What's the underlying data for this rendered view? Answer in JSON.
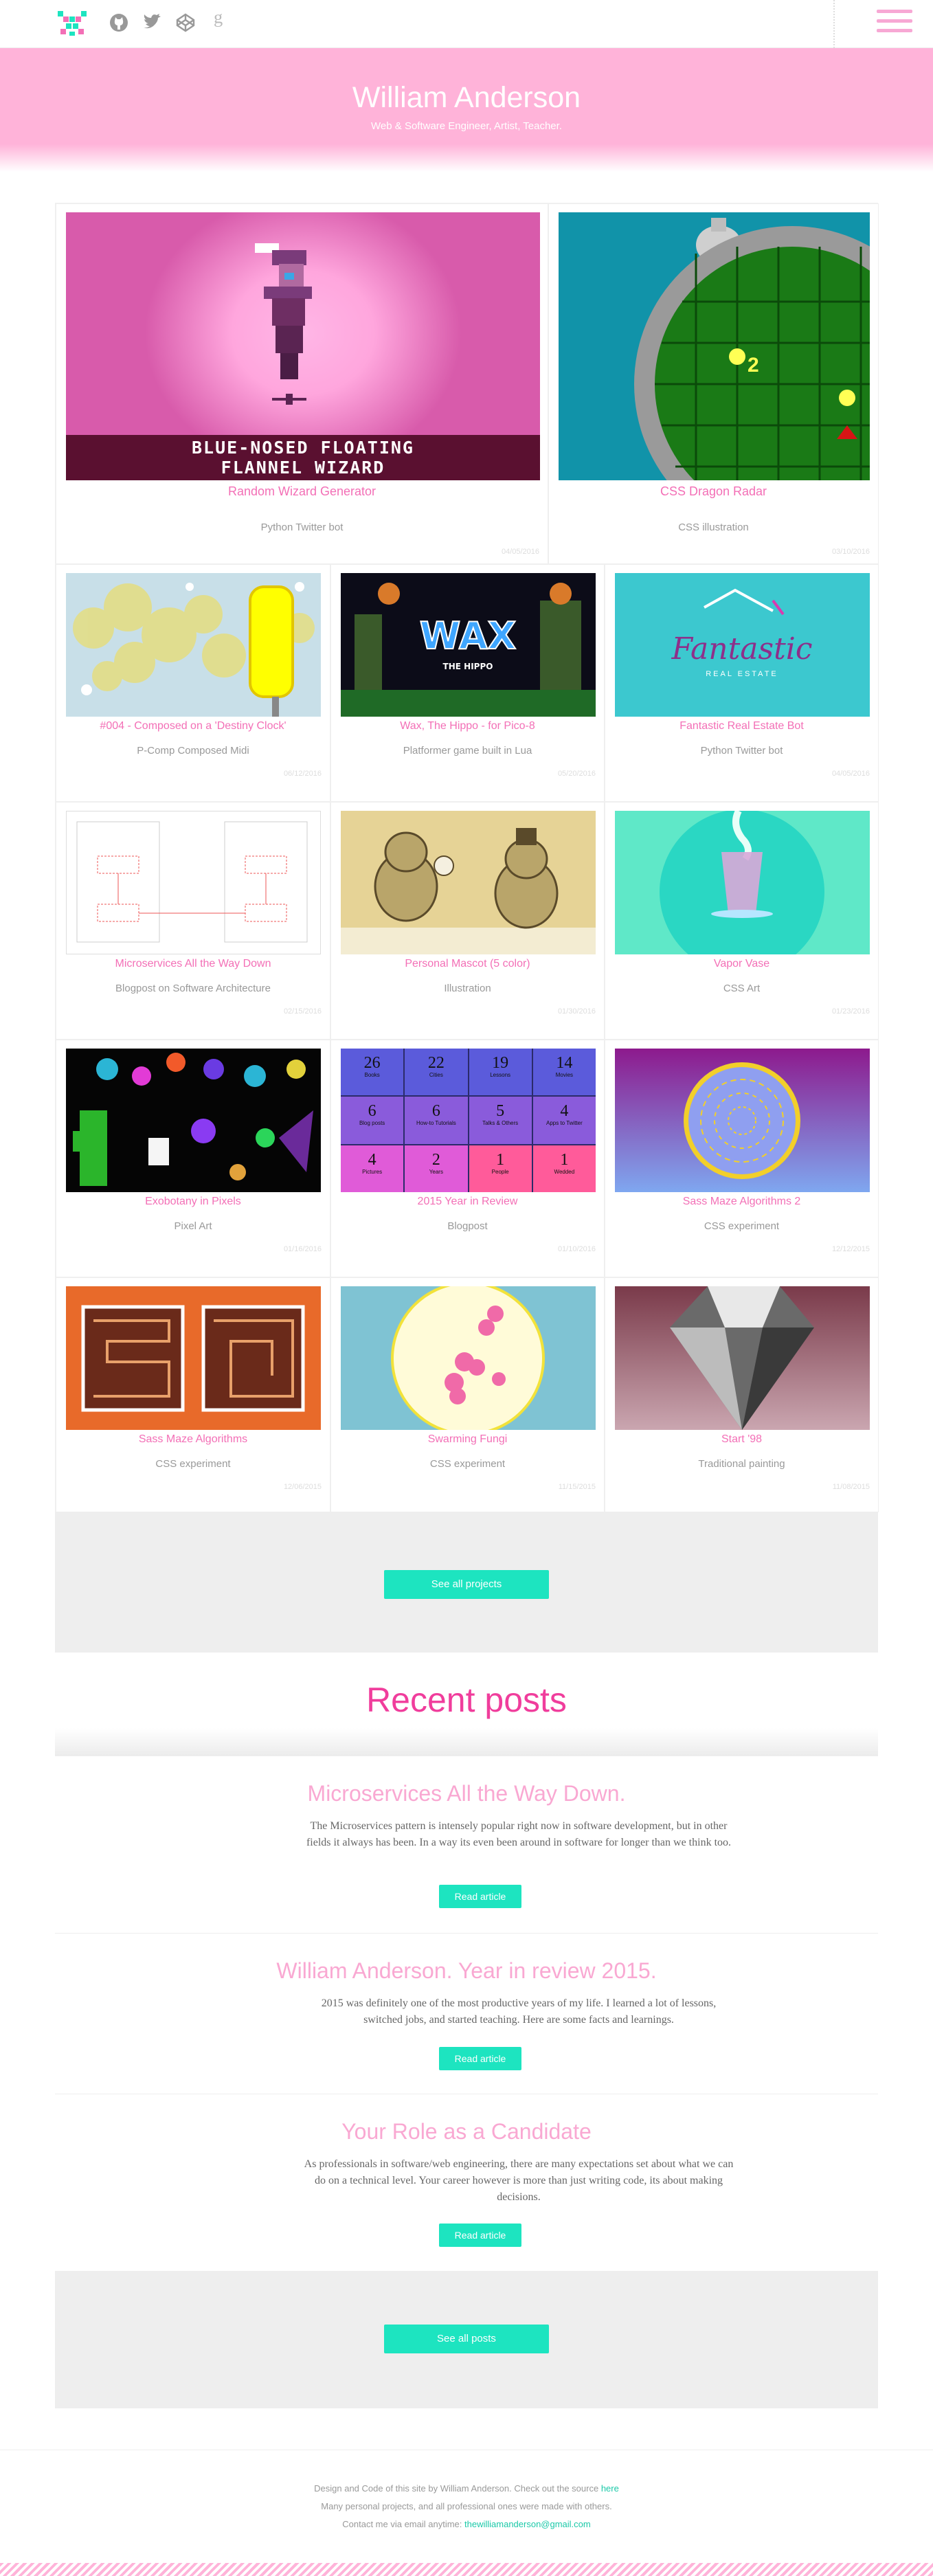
{
  "site": {
    "title": "William Anderson",
    "tagline": "Web & Software Engineer, Artist, Teacher."
  },
  "nav": {
    "icons": [
      "logo-icon",
      "github-icon",
      "twitter-icon",
      "codepen-icon",
      "goodreads-icon"
    ],
    "menu_icon": "hamburger-icon"
  },
  "colors": {
    "accent_pink": "#f36fb6",
    "hero_pink": "#ffb3d9",
    "button_teal": "#1de4c0"
  },
  "projects": [
    {
      "title": "Random Wizard Generator",
      "subtitle": "Python Twitter bot",
      "date": "04/05/2016",
      "thumb_text": [
        "BLUE-NOSED FLOATING",
        "FLANNEL WIZARD"
      ]
    },
    {
      "title": "CSS Dragon Radar",
      "subtitle": "CSS illustration",
      "date": "03/10/2016",
      "thumb_text": [
        "2"
      ]
    },
    {
      "title": "#004 - Composed on a 'Destiny Clock'",
      "subtitle": "P-Comp Composed Midi",
      "date": "06/12/2016"
    },
    {
      "title": "Wax, The Hippo - for Pico-8",
      "subtitle": "Platformer game built in Lua",
      "date": "05/20/2016",
      "thumb_text": [
        "WAX",
        "THE HIPPO"
      ]
    },
    {
      "title": "Fantastic Real Estate Bot",
      "subtitle": "Python Twitter bot",
      "date": "04/05/2016",
      "thumb_text": [
        "Fantastic",
        "REAL ESTATE"
      ]
    },
    {
      "title": "Microservices All the Way Down",
      "subtitle": "Blogpost on Software Architecture",
      "date": "02/15/2016"
    },
    {
      "title": "Personal Mascot (5 color)",
      "subtitle": "Illustration",
      "date": "01/30/2016"
    },
    {
      "title": "Vapor Vase",
      "subtitle": "CSS Art",
      "date": "01/23/2016"
    },
    {
      "title": "Exobotany in Pixels",
      "subtitle": "Pixel Art",
      "date": "01/16/2016"
    },
    {
      "title": "2015 Year in Review",
      "subtitle": "Blogpost",
      "date": "01/10/2016"
    },
    {
      "title": "Sass Maze Algorithms 2",
      "subtitle": "CSS experiment",
      "date": "12/12/2015"
    },
    {
      "title": "Sass Maze Algorithms",
      "subtitle": "CSS experiment",
      "date": "12/06/2015"
    },
    {
      "title": "Swarming Fungi",
      "subtitle": "CSS experiment",
      "date": "11/15/2015"
    },
    {
      "title": "Start '98",
      "subtitle": "Traditional painting",
      "date": "11/08/2015"
    }
  ],
  "year_cells": [
    {
      "n": "26",
      "l": "Books"
    },
    {
      "n": "22",
      "l": "Cities"
    },
    {
      "n": "19",
      "l": "Lessons"
    },
    {
      "n": "14",
      "l": "Movies"
    },
    {
      "n": "6",
      "l": "Blog posts"
    },
    {
      "n": "6",
      "l": "How-to Tutorials"
    },
    {
      "n": "5",
      "l": "Talks & Others"
    },
    {
      "n": "4",
      "l": "Apps to Twitter"
    },
    {
      "n": "4",
      "l": "Pictures"
    },
    {
      "n": "2",
      "l": "Years"
    },
    {
      "n": "1",
      "l": "People"
    },
    {
      "n": "1",
      "l": "Wedded"
    }
  ],
  "buttons": {
    "all_projects": "See all projects",
    "all_posts": "See all posts",
    "read": "Read article"
  },
  "posts_heading": "Recent posts",
  "posts": [
    {
      "title": "Microservices All the Way Down.",
      "body": "The Microservices pattern is intensely popular right now in software development, but in other fields it always has been. In a way its even been around in software for longer than we think too."
    },
    {
      "title": "William Anderson. Year in review 2015.",
      "body": "2015 was definitely one of the most productive years of my life. I learned a lot of lessons, switched jobs, and started teaching. Here are some facts and learnings."
    },
    {
      "title": "Your Role as a Candidate",
      "body": "As professionals in software/web engineering, there are many expectations set about what we can do on a technical level. Your career however is more than just writing code, its about making decisions."
    }
  ],
  "footer": {
    "line1": "Design and Code of this site by William Anderson. Check out the source",
    "line1_link": "here",
    "line2": "Many personal projects, and all professional ones were made with others.",
    "line3": "Contact me via email anytime:",
    "email": "thewilliamanderson@gmail.com"
  }
}
